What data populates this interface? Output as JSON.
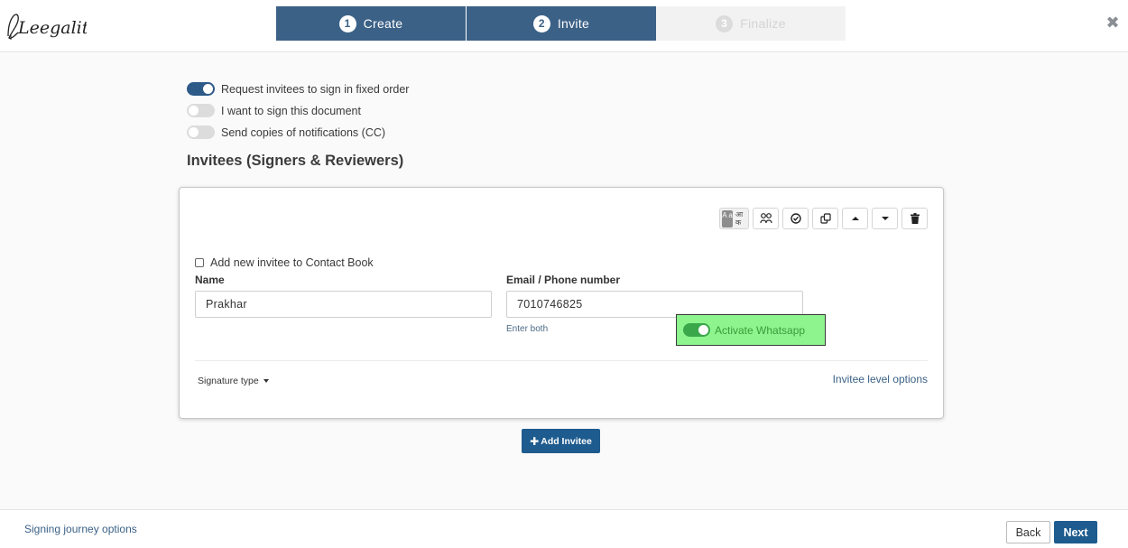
{
  "header": {
    "logo_text": "Leegality",
    "steps": [
      {
        "number": "1",
        "label": "Create",
        "state": "active"
      },
      {
        "number": "2",
        "label": "Invite",
        "state": "active"
      },
      {
        "number": "3",
        "label": "Finalize",
        "state": "inactive"
      }
    ],
    "close_icon": "close-icon",
    "colors": {
      "step_active": "#3b6186",
      "step_inactive": "#f2f2f2"
    }
  },
  "settings": {
    "toggles": [
      {
        "label": "Request invitees to sign in fixed order",
        "checked": true
      },
      {
        "label": "I want to sign this document",
        "checked": false
      },
      {
        "label": "Send copies of notifications (CC)",
        "checked": false
      }
    ]
  },
  "invitees": {
    "title": "Invitees (Signers & Reviewers)",
    "card": {
      "toolbar": {
        "language_badge": {
          "latin": "A a",
          "hindi": "आ क"
        },
        "icons": [
          "users-icon",
          "check-circle-icon",
          "copy-icon",
          "caret-up-icon",
          "caret-down-icon",
          "trash-icon"
        ]
      },
      "add_to_contact_book": {
        "label": "Add new invitee to Contact Book",
        "checked": false
      },
      "name": {
        "label": "Name",
        "value": "Prakhar"
      },
      "contact": {
        "label": "Email / Phone number",
        "value": "7010746825",
        "helper": "Enter both"
      },
      "whatsapp": {
        "label": "Activate Whatsapp",
        "checked": true,
        "highlight_color": "#8ef58e"
      },
      "signature_type_label": "Signature type",
      "invitee_level_options_label": "Invitee level options"
    },
    "add_button_label": "Add Invitee"
  },
  "footer": {
    "journey_link": "Signing journey options",
    "back_label": "Back",
    "next_label": "Next",
    "primary_color": "#1e5b8e"
  }
}
